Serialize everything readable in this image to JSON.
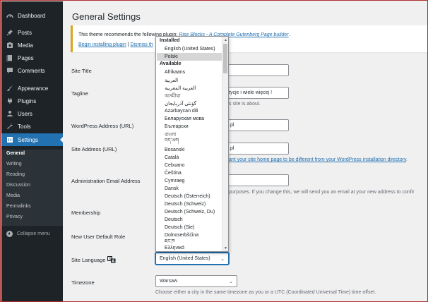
{
  "sidebar": {
    "items": [
      {
        "name": "dashboard",
        "label": "Dashboard",
        "icon": "dashboard-icon"
      },
      {
        "name": "posts",
        "label": "Posts",
        "icon": "pin-icon"
      },
      {
        "name": "media",
        "label": "Media",
        "icon": "media-icon"
      },
      {
        "name": "pages",
        "label": "Pages",
        "icon": "page-icon"
      },
      {
        "name": "comments",
        "label": "Comments",
        "icon": "comment-icon"
      },
      {
        "name": "appearance",
        "label": "Appearance",
        "icon": "brush-icon"
      },
      {
        "name": "plugins",
        "label": "Plugins",
        "icon": "plugin-icon"
      },
      {
        "name": "users",
        "label": "Users",
        "icon": "user-icon"
      },
      {
        "name": "tools",
        "label": "Tools",
        "icon": "wrench-icon"
      },
      {
        "name": "settings",
        "label": "Settings",
        "icon": "settings-icon"
      }
    ],
    "submenu": [
      "General",
      "Writing",
      "Reading",
      "Discussion",
      "Media",
      "Permalinks",
      "Privacy"
    ],
    "collapse_label": "Collapse menu"
  },
  "page": {
    "title": "General Settings"
  },
  "notice": {
    "text": "This theme recommends the following plugin: ",
    "plugin_link": "Rise Blocks - A Complete Gutenberg Page builder",
    "text_end": ".",
    "install_link": "Begin installing plugin",
    "separator": " | ",
    "dismiss_link": "Dismiss th"
  },
  "fields": {
    "site_title_label": "Site Title",
    "tagline_label": "Tagline",
    "tagline_value": "ystycje i wiele więcej !",
    "tagline_desc": "s site is about.",
    "wp_address_label": "WordPress Address (URL)",
    "wp_address_value": ".pl",
    "site_address_label": "Site Address (URL)",
    "site_address_value": ".pl",
    "site_address_desc_link": "ant your site home page to be different from your WordPress installation directory",
    "site_address_desc_end": ".",
    "admin_email_label": "Administration Email Address",
    "admin_email_desc": "purposes. If you change this, we will send you an email at your new address to confir",
    "membership_label": "Membership",
    "default_role_label": "New User Default Role",
    "site_language_label": "Site Language",
    "site_language_value": "English (United States)",
    "timezone_label": "Timezone",
    "timezone_value": "Warsaw",
    "timezone_desc": "Choose either a city in the same timezone as you or a UTC (Coordinated Universal Time) time offset."
  },
  "dropdown": {
    "installed_label": "Installed",
    "installed": [
      "English (United States)",
      "Polski"
    ],
    "selected": "Polski",
    "available_label": "Available",
    "available": [
      "Afrikaans",
      "العربية",
      "العربية المغربية",
      "অসমীয়া",
      "گؤنئی آذربایجان",
      "Azərbaycan dili",
      "Беларуская мова",
      "Български",
      "বাংলা",
      "བོད་ཡིག",
      "Bosanski",
      "Català",
      "Cebuano",
      "Čeština",
      "Cymraeg",
      "Dansk",
      "Deutsch (Österreich)",
      "Deutsch (Schweiz)",
      "Deutsch (Schweiz, Du)",
      "Deutsch",
      "Deutsch (Sie)",
      "Dolnoserbšćina",
      "ཇོང་ཁ",
      "Ελληνικά"
    ]
  },
  "colors": {
    "sidebar_bg": "#1d2327",
    "accent": "#2271b1",
    "notice_border": "#dba617"
  }
}
